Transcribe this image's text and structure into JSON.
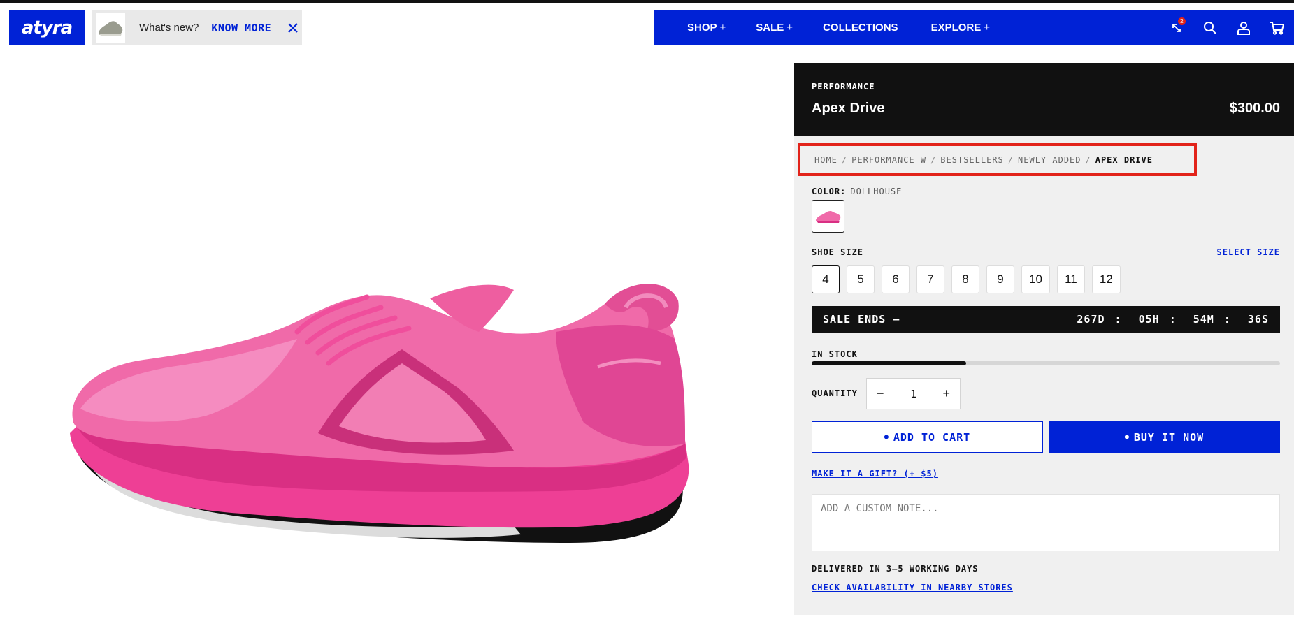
{
  "brand": {
    "logo_text": "atyra",
    "accent": "#0022d6"
  },
  "promo": {
    "text": "What's new?",
    "link": "KNOW MORE"
  },
  "nav": {
    "items": [
      {
        "label": "SHOP",
        "suffix": "+"
      },
      {
        "label": "SALE",
        "suffix": "+"
      },
      {
        "label": "COLLECTIONS",
        "suffix": ""
      },
      {
        "label": "EXPLORE",
        "suffix": "+"
      }
    ],
    "compare_badge": "2",
    "icons": [
      "compare-icon",
      "search-icon",
      "account-icon",
      "cart-icon"
    ]
  },
  "product": {
    "category": "PERFORMANCE",
    "name": "Apex Drive",
    "price": "$300.00",
    "image_color": "#ee3f95"
  },
  "breadcrumb": [
    "HOME",
    "PERFORMANCE W",
    "BESTSELLERS",
    "NEWLY ADDED",
    "APEX DRIVE"
  ],
  "color": {
    "label": "COLOR:",
    "value": "DOLLHOUSE"
  },
  "size": {
    "label": "SHOE SIZE",
    "select_link": "SELECT SIZE",
    "options": [
      "4",
      "5",
      "6",
      "7",
      "8",
      "9",
      "10",
      "11",
      "12"
    ],
    "selected": "4"
  },
  "sale": {
    "label": "SALE ENDS —",
    "days": "267D",
    "hours": "05H",
    "minutes": "54M",
    "seconds": "36S"
  },
  "stock": {
    "label": "IN STOCK",
    "level": 0.33
  },
  "quantity": {
    "label": "QUANTITY",
    "value": "1",
    "minus": "−",
    "plus": "+"
  },
  "buttons": {
    "add_to_cart": "ADD TO CART",
    "buy_now": "BUY IT NOW"
  },
  "gift_link": "MAKE IT A GIFT? (+ $5)",
  "note": {
    "placeholder": "ADD A CUSTOM NOTE..."
  },
  "delivery": "DELIVERED IN 3–5 WORKING DAYS",
  "availability_link": "CHECK AVAILABILITY IN NEARBY STORES"
}
